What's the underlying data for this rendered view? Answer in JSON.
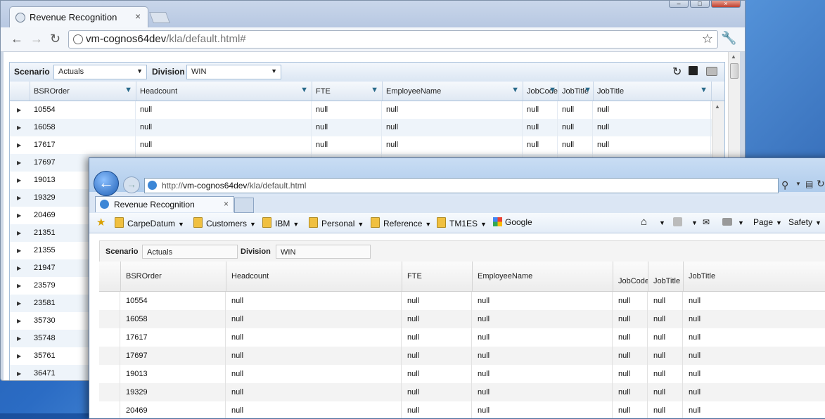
{
  "chrome": {
    "tab_title": "Revenue Recognition",
    "url_host": "vm-cognos64dev",
    "url_path": "/kla/default.html#",
    "filters": {
      "scenario_label": "Scenario",
      "scenario_value": "Actuals",
      "division_label": "Division",
      "division_value": "WIN"
    },
    "columns": [
      "BSROrder",
      "Headcount",
      "FTE",
      "EmployeeName",
      "JobCode",
      "JobTitle",
      "JobTitle"
    ],
    "rows": [
      [
        "10554",
        "null",
        "null",
        "null",
        "null",
        "null",
        "null"
      ],
      [
        "16058",
        "null",
        "null",
        "null",
        "null",
        "null",
        "null"
      ],
      [
        "17617",
        "null",
        "null",
        "null",
        "null",
        "null",
        "null"
      ],
      [
        "17697",
        "",
        "",
        "",
        "",
        "",
        ""
      ],
      [
        "19013",
        "",
        "",
        "",
        "",
        "",
        ""
      ],
      [
        "19329",
        "",
        "",
        "",
        "",
        "",
        ""
      ],
      [
        "20469",
        "",
        "",
        "",
        "",
        "",
        ""
      ],
      [
        "21351",
        "",
        "",
        "",
        "",
        "",
        ""
      ],
      [
        "21355",
        "",
        "",
        "",
        "",
        "",
        ""
      ],
      [
        "21947",
        "",
        "",
        "",
        "",
        "",
        ""
      ],
      [
        "23579",
        "",
        "",
        "",
        "",
        "",
        ""
      ],
      [
        "23581",
        "",
        "",
        "",
        "",
        "",
        ""
      ],
      [
        "35730",
        "",
        "",
        "",
        "",
        "",
        ""
      ],
      [
        "35748",
        "",
        "",
        "",
        "",
        "",
        ""
      ],
      [
        "35761",
        "",
        "",
        "",
        "",
        "",
        ""
      ],
      [
        "36471",
        "",
        "",
        "",
        "",
        "",
        ""
      ]
    ]
  },
  "ie": {
    "url_prefix": "http://",
    "url_host": "vm-cognos64dev",
    "url_path": "/kla/default.html",
    "tab_title": "Revenue Recognition",
    "favorites": [
      "CarpeDatum",
      "Customers",
      "IBM",
      "Personal",
      "Reference",
      "TM1ES",
      "Google"
    ],
    "command_bar": {
      "page": "Page",
      "safety": "Safety"
    },
    "filters": {
      "scenario_label": "Scenario",
      "scenario_value": "Actuals",
      "division_label": "Division",
      "division_value": "WIN"
    },
    "columns": [
      "BSROrder",
      "Headcount",
      "FTE",
      "EmployeeName",
      "JobCode",
      "JobTitle",
      "JobTitle"
    ],
    "rows": [
      [
        "10554",
        "null",
        "null",
        "null",
        "null",
        "null",
        "null"
      ],
      [
        "16058",
        "null",
        "null",
        "null",
        "null",
        "null",
        "null"
      ],
      [
        "17617",
        "null",
        "null",
        "null",
        "null",
        "null",
        "null"
      ],
      [
        "17697",
        "null",
        "null",
        "null",
        "null",
        "null",
        "null"
      ],
      [
        "19013",
        "null",
        "null",
        "null",
        "null",
        "null",
        "null"
      ],
      [
        "19329",
        "null",
        "null",
        "null",
        "null",
        "null",
        "null"
      ],
      [
        "20469",
        "null",
        "null",
        "null",
        "null",
        "null",
        "null"
      ]
    ]
  },
  "colors": {
    "desktop": "#2b6cc4",
    "grid_header": "#dfe8f3",
    "alt_row": "#eef4fa",
    "filter_icon": "#2a6a8a"
  }
}
